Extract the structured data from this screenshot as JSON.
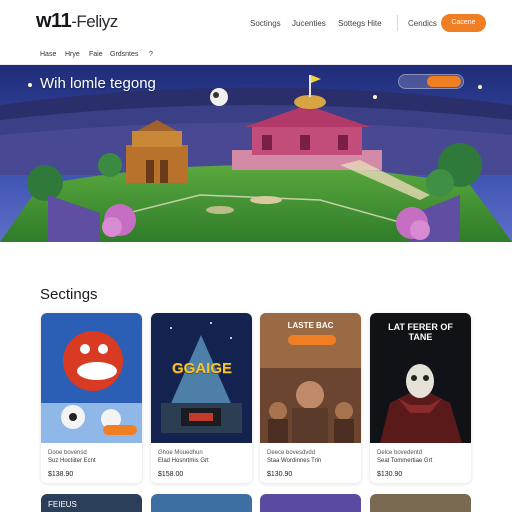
{
  "header": {
    "logo_main": "w11",
    "logo_suffix": "-Feliyz",
    "nav": [
      "Soctings",
      "Jucenties",
      "Sottegs Hite"
    ],
    "secondary_link": "Cendics",
    "cta_label": "Cacene"
  },
  "subnav": [
    "Hase",
    "Hrye",
    "Faie",
    "Grdsntes",
    "?"
  ],
  "hero": {
    "title": "Wih lomle tegong",
    "subtitle": "",
    "pill_label": ""
  },
  "section": {
    "title": "Sectings"
  },
  "cards": [
    {
      "art_text": "",
      "line1": "Dooe bovensd",
      "line2": "Suz Hoctiiter Ecnt",
      "price": "$138.90",
      "accent": "#ef7f22"
    },
    {
      "art_text": "GGAIGE",
      "line1": "Ghoe Mouedhun",
      "line2": "Elad Hosnrtmis Grt",
      "price": "$158.00"
    },
    {
      "art_text": "LASTE BAC",
      "line1": "Deece bovesdvdd",
      "line2": "Staa Wordinnes Trin",
      "price": "$130.90"
    },
    {
      "art_text": "LAT FERER OF TANE",
      "line1": "Delce bovedentd",
      "line2": "Seat Tommertiae Grt",
      "price": "$130.90"
    }
  ],
  "cards_row2": [
    {
      "label": "FEIEUS"
    },
    {
      "label": ""
    },
    {
      "label": ""
    },
    {
      "label": ""
    }
  ],
  "colors": {
    "accent": "#ef7f22",
    "hero_sky": "#2b3a8a"
  }
}
